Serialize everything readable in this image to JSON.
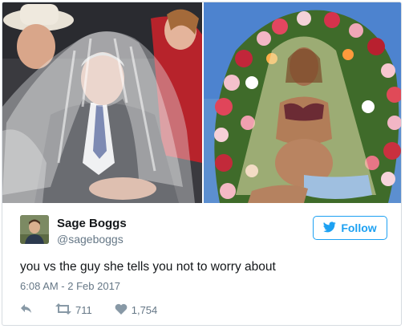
{
  "tweet": {
    "author_name": "Sage Boggs",
    "author_handle": "@sageboggs",
    "follow_label": "Follow",
    "text": "you vs the guy she tells you not to worry about",
    "timestamp": "6:08 AM - 2 Feb 2017",
    "retweet_count": "711",
    "like_count": "1,754"
  },
  "icons": {
    "reply": "reply-icon",
    "retweet": "retweet-icon",
    "like": "heart-icon",
    "follow": "twitter-bird-icon"
  },
  "colors": {
    "accent": "#1da1f2",
    "text": "#14171a",
    "muted": "#657786"
  }
}
